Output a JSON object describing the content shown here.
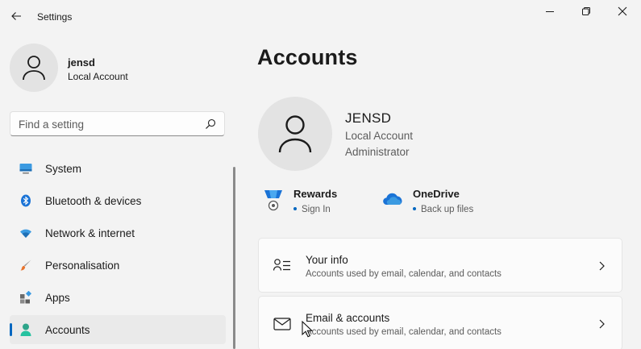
{
  "window": {
    "title": "Settings",
    "minimize_glyph": "minimize-icon",
    "maximize_glyph": "restore-icon",
    "close_glyph": "close-icon"
  },
  "profile": {
    "name": "jensd",
    "account_type": "Local Account"
  },
  "search": {
    "placeholder": "Find a setting",
    "value": ""
  },
  "sidebar": {
    "items": [
      {
        "label": "System",
        "icon": "monitor-icon",
        "active": false
      },
      {
        "label": "Bluetooth & devices",
        "icon": "bluetooth-icon",
        "active": false
      },
      {
        "label": "Network & internet",
        "icon": "wifi-icon",
        "active": false
      },
      {
        "label": "Personalisation",
        "icon": "paintbrush-icon",
        "active": false
      },
      {
        "label": "Apps",
        "icon": "apps-icon",
        "active": false
      },
      {
        "label": "Accounts",
        "icon": "person-icon",
        "active": true
      }
    ]
  },
  "main": {
    "title": "Accounts",
    "user": {
      "name": "JENSD",
      "account_type": "Local Account",
      "role": "Administrator"
    },
    "services": [
      {
        "title": "Rewards",
        "subtitle": "Sign In",
        "icon": "rewards-medal-icon"
      },
      {
        "title": "OneDrive",
        "subtitle": "Back up files",
        "icon": "onedrive-cloud-icon"
      }
    ],
    "cards": [
      {
        "title": "Your info",
        "subtitle": "Accounts used by email, calendar, and contacts",
        "icon": "person-card-icon"
      },
      {
        "title": "Email & accounts",
        "subtitle": "Accounts used by email, calendar, and contacts",
        "icon": "mail-icon"
      }
    ]
  },
  "colors": {
    "accent": "#0067c0",
    "background": "#f3f3f3",
    "card": "#fbfbfb",
    "secondary_text": "#5c5c5c"
  }
}
